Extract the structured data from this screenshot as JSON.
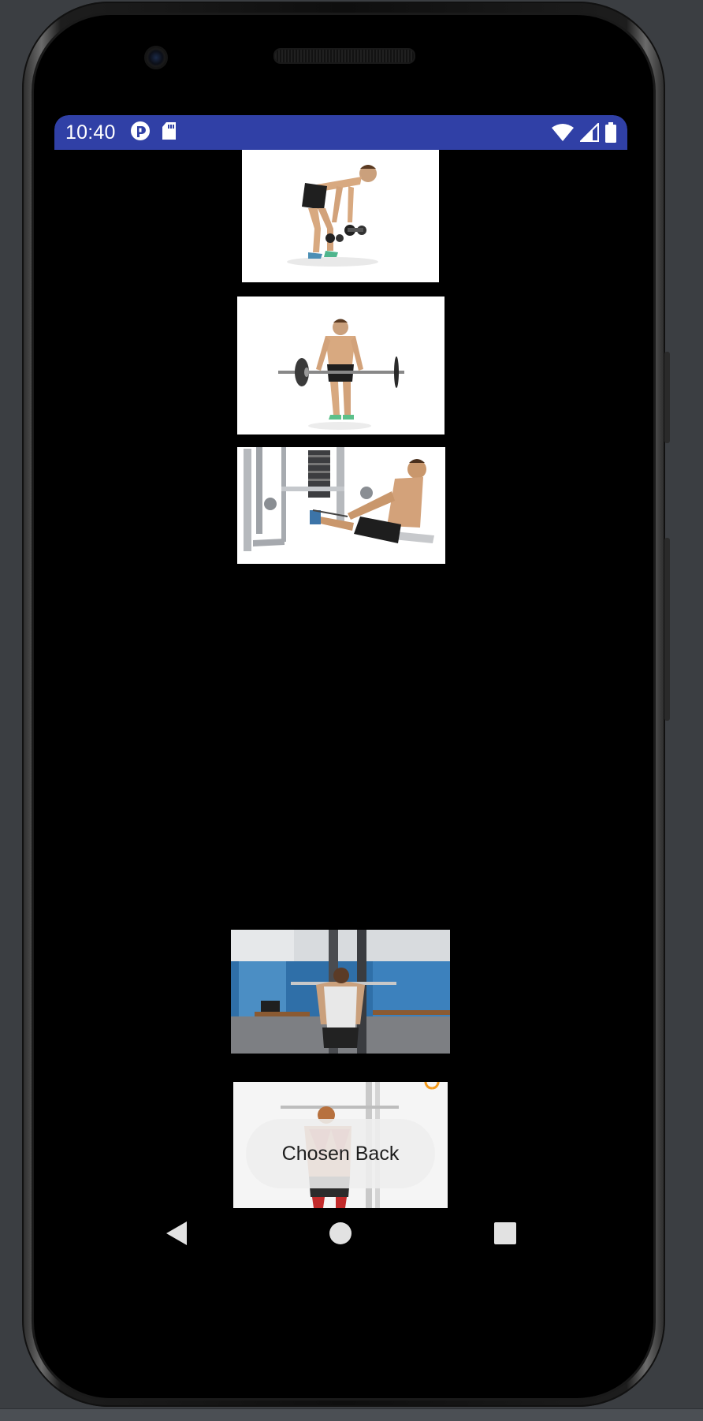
{
  "status_bar": {
    "time": "10:40",
    "background": "#3040a6",
    "left_icons": [
      "app-notification-icon",
      "sd-card-icon"
    ],
    "right_icons": [
      "wifi-icon",
      "cell-signal-icon",
      "battery-icon"
    ]
  },
  "exercise_images": [
    {
      "name": "dumbbell-row-image",
      "depicts": "bent-over dumbbell row"
    },
    {
      "name": "barbell-row-image",
      "depicts": "bent-over barbell row"
    },
    {
      "name": "seated-cable-row-image",
      "depicts": "seated cable row"
    },
    {
      "name": "lat-pulldown-image",
      "depicts": "behind-the-neck lat pulldown in gym"
    },
    {
      "name": "lat-pulldown-diagram-image",
      "depicts": "lat pulldown muscle diagram"
    }
  ],
  "toast": {
    "text": "Chosen Back"
  },
  "nav_bar": {
    "buttons": [
      "back-icon",
      "home-icon",
      "recents-icon"
    ]
  }
}
